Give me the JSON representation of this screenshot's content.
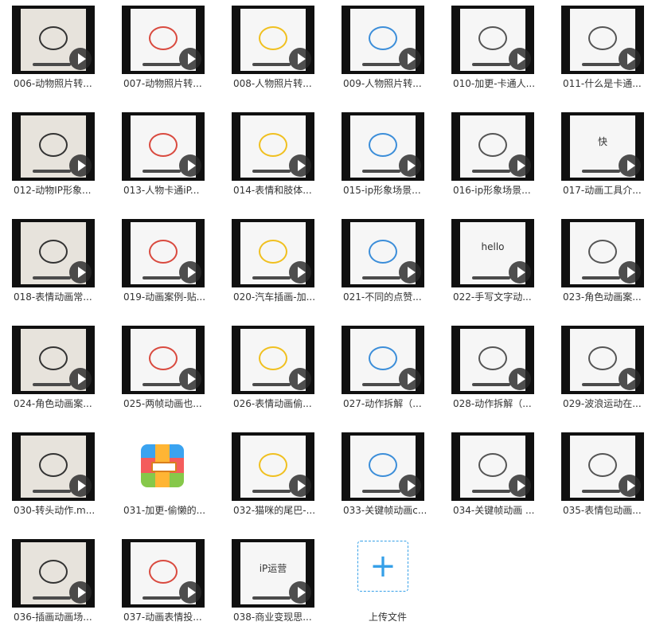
{
  "files": [
    {
      "name": "006-动物照片转...",
      "kind": "video"
    },
    {
      "name": "007-动物照片转...",
      "kind": "video"
    },
    {
      "name": "008-人物照片转...",
      "kind": "video"
    },
    {
      "name": "009-人物照片转...",
      "kind": "video"
    },
    {
      "name": "010-加更-卡通人...",
      "kind": "video"
    },
    {
      "name": "011-什么是卡通...",
      "kind": "video"
    },
    {
      "name": "012-动物IP形象...",
      "kind": "video"
    },
    {
      "name": "013-人物卡通iP...",
      "kind": "video"
    },
    {
      "name": "014-表情和肢体...",
      "kind": "video"
    },
    {
      "name": "015-ip形象场景...",
      "kind": "video"
    },
    {
      "name": "016-ip形象场景...",
      "kind": "video"
    },
    {
      "name": "017-动画工具介...",
      "kind": "video"
    },
    {
      "name": "018-表情动画常...",
      "kind": "video"
    },
    {
      "name": "019-动画案例-贴...",
      "kind": "video"
    },
    {
      "name": "020-汽车插画-加...",
      "kind": "video"
    },
    {
      "name": "021-不同的点赞...",
      "kind": "video"
    },
    {
      "name": "022-手写文字动...",
      "kind": "video"
    },
    {
      "name": "023-角色动画案...",
      "kind": "video"
    },
    {
      "name": "024-角色动画案...",
      "kind": "video"
    },
    {
      "name": "025-两帧动画也...",
      "kind": "video"
    },
    {
      "name": "026-表情动画偷...",
      "kind": "video"
    },
    {
      "name": "027-动作拆解（...",
      "kind": "video"
    },
    {
      "name": "028-动作拆解（...",
      "kind": "video"
    },
    {
      "name": "029-波浪运动在...",
      "kind": "video"
    },
    {
      "name": "030-转头动作.m...",
      "kind": "video"
    },
    {
      "name": "031-加更-偷懒的...",
      "kind": "archive"
    },
    {
      "name": "032-猫咪的尾巴-...",
      "kind": "video"
    },
    {
      "name": "033-关键帧动画c...",
      "kind": "video"
    },
    {
      "name": "034-关键帧动画 ...",
      "kind": "video"
    },
    {
      "name": "035-表情包动画...",
      "kind": "video"
    },
    {
      "name": "036-插画动画场...",
      "kind": "video"
    },
    {
      "name": "037-动画表情投...",
      "kind": "video"
    },
    {
      "name": "038-商业变现思...",
      "kind": "video"
    }
  ],
  "upload": {
    "label": "上传文件",
    "icon": "plus-icon",
    "color": "#36a0e8"
  },
  "thumb_texts": {
    "17": "快",
    "22": "hello",
    "38": "iP运营"
  }
}
